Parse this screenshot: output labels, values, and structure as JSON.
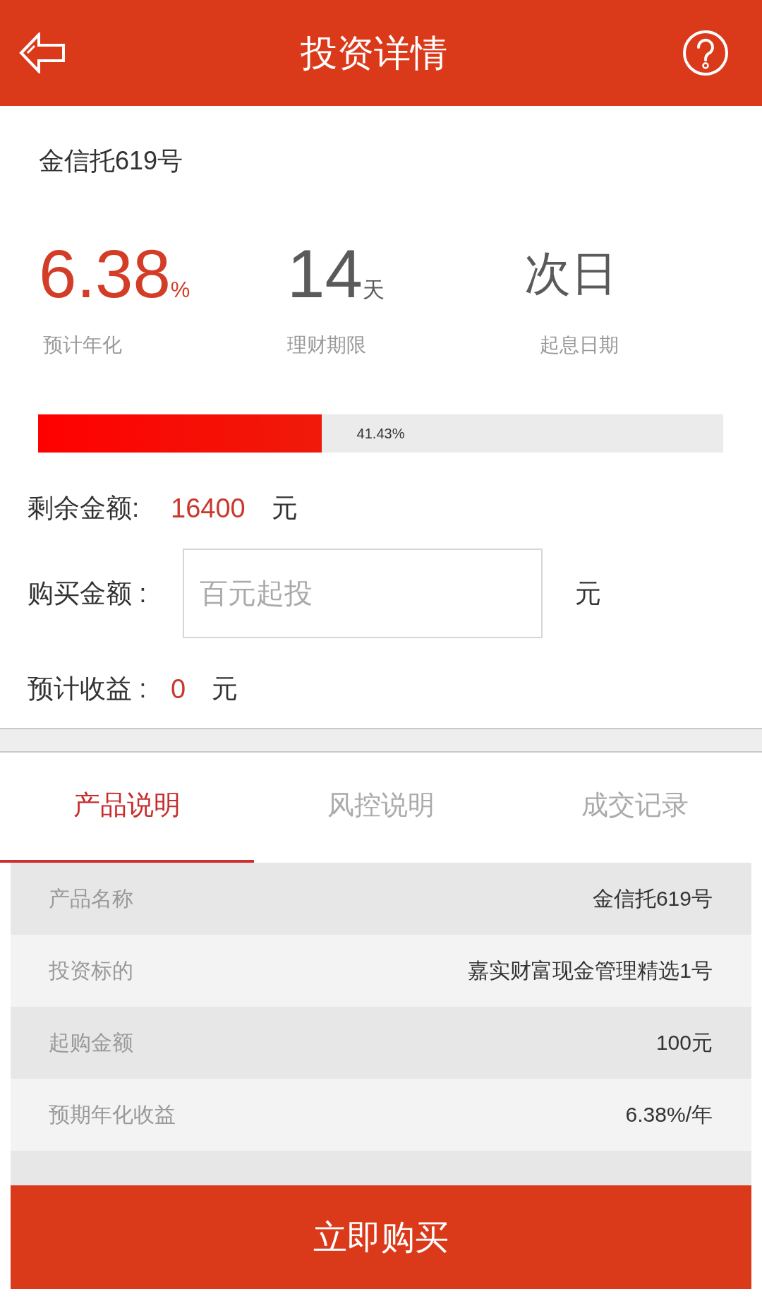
{
  "header": {
    "title": "投资详情"
  },
  "product": {
    "name": "金信托619号"
  },
  "stats": [
    {
      "kind": "percent",
      "value": "6.38",
      "unit": "%",
      "label": "预计年化"
    },
    {
      "kind": "number",
      "value": "14",
      "unit": "天",
      "label": "理财期限"
    },
    {
      "kind": "text",
      "value": "次日",
      "label": "起息日期"
    }
  ],
  "progress": {
    "level": 0.4143,
    "reading": "41.43%"
  },
  "form": [
    {
      "kind": "reading",
      "label": "剩余金额:",
      "value": "16400",
      "unit": "元"
    },
    {
      "kind": "input",
      "label": "购买金额 :",
      "placeholder": "百元起投",
      "unit": "元"
    },
    {
      "kind": "reading",
      "label": "预计收益 :",
      "value": "0",
      "unit": "元"
    }
  ],
  "tabs": [
    {
      "label": "产品说明",
      "selected": true
    },
    {
      "label": "风控说明",
      "selected": false
    },
    {
      "label": "成交记录",
      "selected": false
    }
  ],
  "details": {
    "rows": [
      {
        "label": "产品名称",
        "value": "金信托619号"
      },
      {
        "label": "投资标的",
        "value": "嘉实财富现金管理精选1号"
      },
      {
        "label": "起购金额",
        "value": "100元"
      },
      {
        "label": "预期年化收益",
        "value": "6.38%/年"
      }
    ]
  },
  "buy_button": {
    "label": "立即购买"
  }
}
